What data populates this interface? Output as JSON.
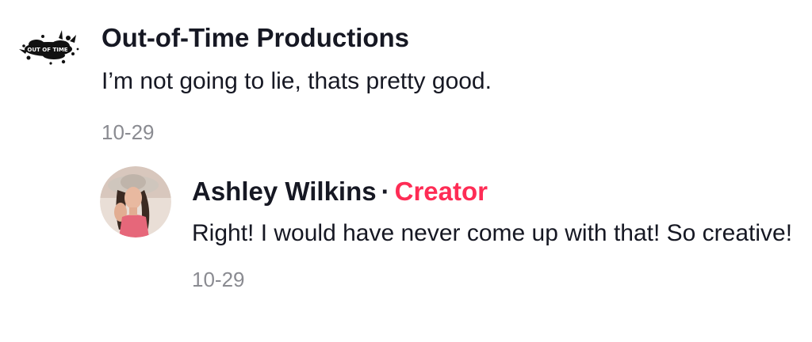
{
  "comments": [
    {
      "username": "Out-of-Time Productions",
      "text": "I’m not going to lie, thats pretty good.",
      "date": "10-29",
      "avatar_icon": "out-of-time-logo",
      "avatar_text": "OUT OF TIME"
    }
  ],
  "reply": {
    "username": "Ashley Wilkins",
    "separator": "·",
    "badge": "Creator",
    "text": "Right! I would have never come up with that! So creative!",
    "date": "10-29",
    "avatar_icon": "user-photo-avatar"
  },
  "colors": {
    "badge": "#fe2c55",
    "timestamp": "#8a8b91",
    "text": "#161823"
  }
}
